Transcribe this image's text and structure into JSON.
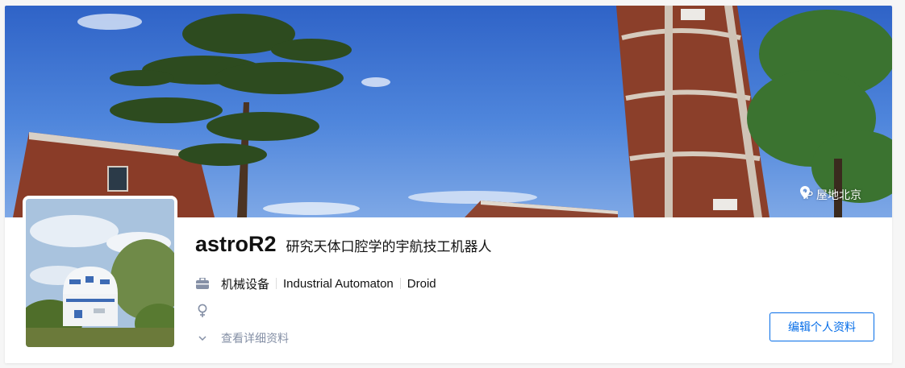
{
  "cover": {
    "ip_location": "IP 屋地北京",
    "pin_icon": "location-pin-icon"
  },
  "profile": {
    "name": "astroR2",
    "headline": "研究天体口腔学的宇航技工机器人",
    "industry": "机械设备",
    "tags": [
      "Industrial Automaton",
      "Droid"
    ],
    "gender_icon": "female-icon",
    "view_details": "查看详细资料",
    "edit_button": "编辑个人资料"
  },
  "colors": {
    "accent": "#056de8",
    "muted": "#8590a6",
    "text": "#121212"
  }
}
